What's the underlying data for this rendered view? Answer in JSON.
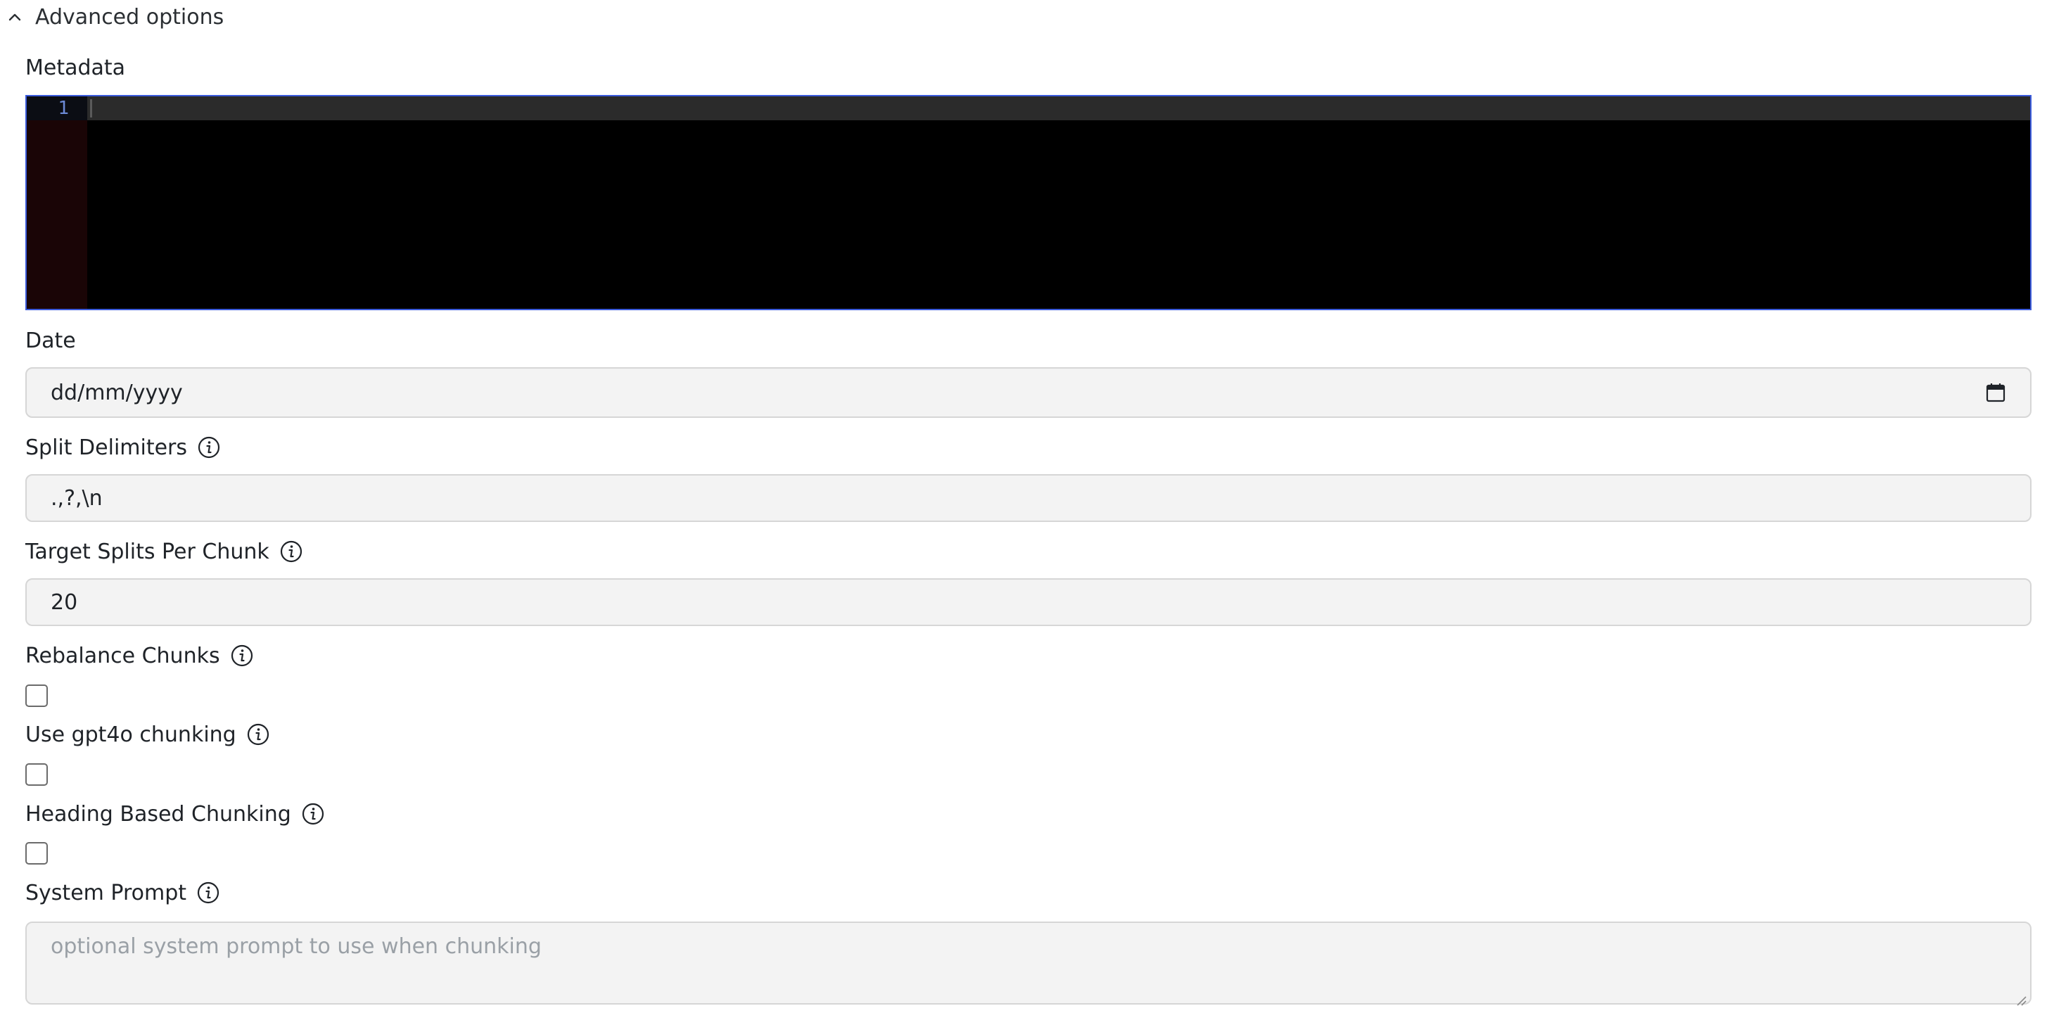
{
  "advanced": {
    "label": "Advanced options",
    "icon": "chevron-up-icon"
  },
  "metadata": {
    "label": "Metadata",
    "line_number": "1",
    "content": ""
  },
  "date": {
    "label": "Date",
    "placeholder": "dd/mm/yyyy",
    "icon": "calendar-icon"
  },
  "split_delimiters": {
    "label": "Split Delimiters",
    "value": ".,?,\\n"
  },
  "target_splits": {
    "label": "Target Splits Per Chunk",
    "value": "20"
  },
  "rebalance": {
    "label": "Rebalance Chunks",
    "checked": false
  },
  "gpt4o": {
    "label": "Use gpt4o chunking",
    "checked": false
  },
  "heading": {
    "label": "Heading Based Chunking",
    "checked": false
  },
  "system_prompt": {
    "label": "System Prompt",
    "placeholder": "optional system prompt to use when chunking"
  },
  "colors": {
    "editor_border": "#3b5bdb",
    "editor_bg": "#000000",
    "gutter_bg": "#1a0506",
    "line_number": "#6c8ad6",
    "field_bg": "#f3f3f3"
  }
}
